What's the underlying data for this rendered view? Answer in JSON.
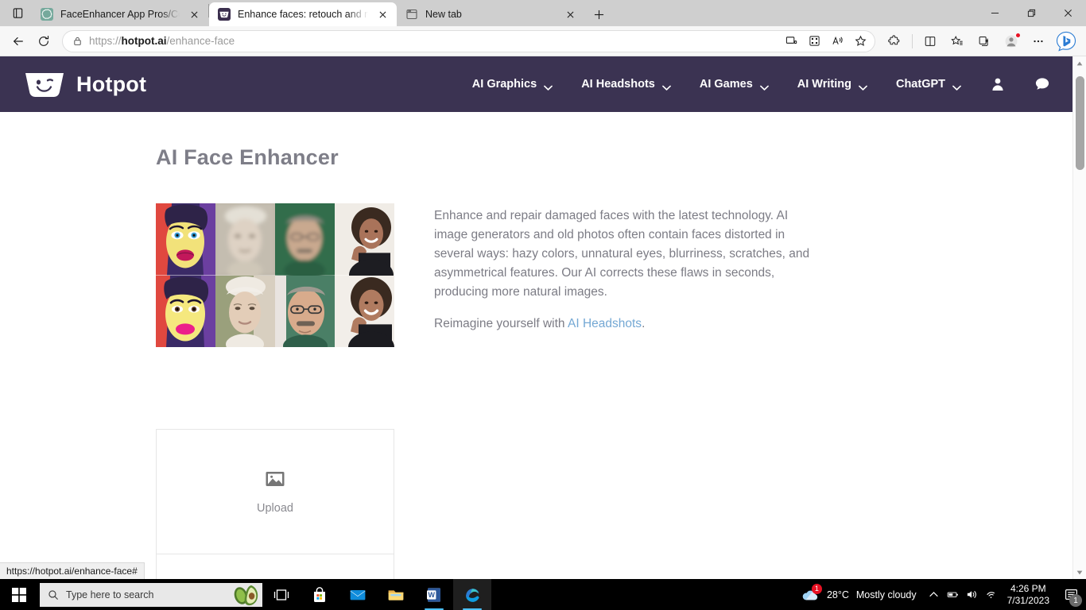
{
  "browser": {
    "tabs": [
      {
        "title": "FaceEnhancer App Pros/Cons, No",
        "favicon": "chatgpt-icon",
        "active": false
      },
      {
        "title": "Enhance faces: retouch and repai",
        "favicon": "hotpot-icon",
        "active": true
      },
      {
        "title": "New tab",
        "favicon": "newtab-icon",
        "active": false
      }
    ],
    "new_tab_button": "+",
    "window_controls": {
      "minimize": "minimize-icon",
      "restore": "restore-icon",
      "close": "close-icon"
    },
    "nav": {
      "back": "back-arrow-icon",
      "reload": "reload-icon"
    },
    "address": {
      "lock": "lock-icon",
      "scheme": "https://",
      "domain": "hotpot.ai",
      "path": "/enhance-face"
    },
    "omnibox_icons": [
      "cast-icon",
      "qr-code-icon",
      "read-aloud-icon",
      "favorite-star-icon"
    ],
    "toolbar_icons": [
      "extensions-icon",
      "split-screen-icon",
      "favorites-list-icon",
      "collections-icon",
      "profile-avatar-icon",
      "settings-more-icon",
      "bing-chat-icon"
    ],
    "status_bar": "https://hotpot.ai/enhance-face#"
  },
  "site": {
    "brand": {
      "name": "Hotpot",
      "logo": "hotpot-pot-logo"
    },
    "nav_items": [
      {
        "label": "AI Graphics",
        "caret": "chevron-down-icon"
      },
      {
        "label": "AI Headshots",
        "caret": "chevron-down-icon"
      },
      {
        "label": "AI Games",
        "caret": "chevron-down-icon"
      },
      {
        "label": "AI Writing",
        "caret": "chevron-down-icon"
      },
      {
        "label": "ChatGPT",
        "caret": "chevron-down-icon"
      }
    ],
    "account_icon": "user-account-icon",
    "chat_icon": "chat-bubble-icon",
    "header_bg": "#3b3352"
  },
  "main": {
    "title": "AI Face Enhancer",
    "paragraph_1": "Enhance and repair damaged faces with the latest technology. AI image generators and old photos often contain faces distorted in several ways: hazy colors, unnatural eyes, blurriness, scratches, and asymmetrical features. Our AI corrects these flaws in seconds, producing more natural images.",
    "paragraph_2_prefix": "Reimagine yourself with ",
    "paragraph_2_link": "AI Headshots",
    "paragraph_2_suffix": ".",
    "link_color": "#74a8d4",
    "collage_alt": "before-and-after face enhancement grid",
    "upload": {
      "icon": "image-placeholder-icon",
      "label": "Upload"
    }
  },
  "taskbar": {
    "start": "windows-start-icon",
    "search_placeholder": "Type here to search",
    "search_icon": "magnifier-icon",
    "avocado": "avocado-image",
    "apps": [
      {
        "name": "task-view-icon"
      },
      {
        "name": "microsoft-store-icon"
      },
      {
        "name": "mail-icon"
      },
      {
        "name": "file-explorer-icon"
      },
      {
        "name": "word-icon"
      },
      {
        "name": "edge-icon"
      }
    ],
    "weather": {
      "icon": "cloud-icon",
      "badge": "1",
      "temperature": "28°C",
      "condition": "Mostly cloudy"
    },
    "tray_icons": [
      "chevron-up-icon",
      "battery-icon",
      "volume-icon",
      "wifi-icon"
    ],
    "time": "4:26 PM",
    "date": "7/31/2023",
    "notifications": {
      "icon": "notification-icon",
      "count": "1"
    }
  }
}
